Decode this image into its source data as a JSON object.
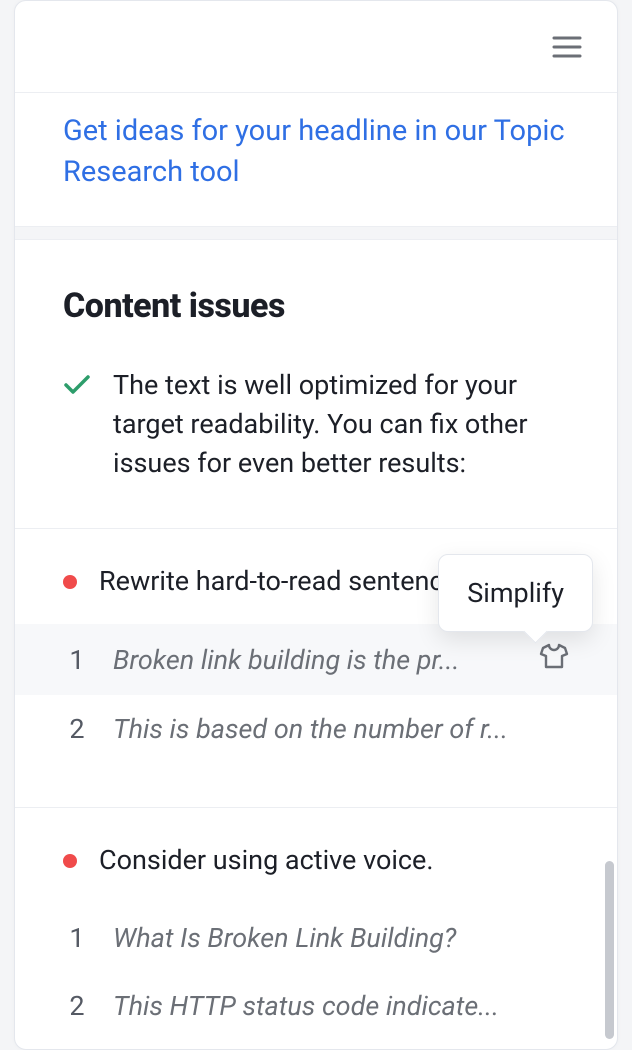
{
  "ideasLink": "Get ideas for your headline in our Topic Research tool",
  "sectionTitle": "Content issues",
  "optimizedMessage": "The text is well optimized for your target readability. You can fix other issues for even better results:",
  "tooltip": "Simplify",
  "groups": [
    {
      "title": "Rewrite hard-to-read sentences.",
      "items": [
        {
          "num": "1",
          "text": "Broken link building is the pr...",
          "highlight": true,
          "hasShirt": true
        },
        {
          "num": "2",
          "text": "This is based on the number of r...",
          "highlight": false,
          "hasShirt": false
        }
      ]
    },
    {
      "title": "Consider using active voice.",
      "items": [
        {
          "num": "1",
          "text": "What Is Broken Link Building?",
          "highlight": false,
          "hasShirt": false
        },
        {
          "num": "2",
          "text": "This HTTP status code indicate...",
          "highlight": false,
          "hasShirt": false
        }
      ]
    }
  ]
}
